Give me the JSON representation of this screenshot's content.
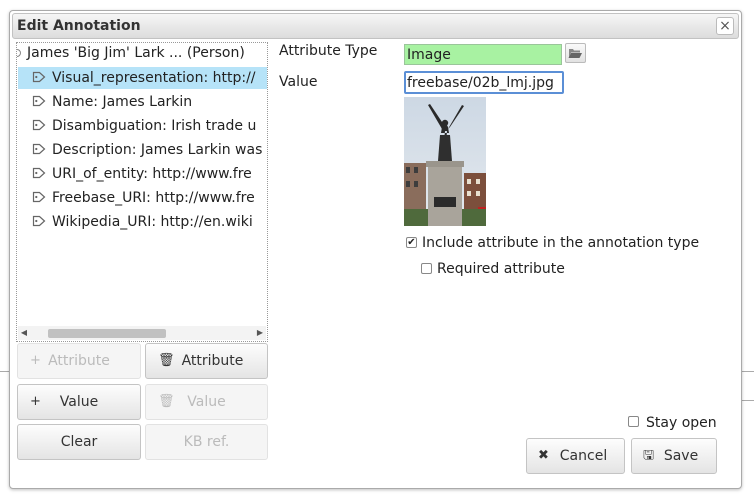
{
  "dialog": {
    "title": "Edit Annotation",
    "close_glyph": "×"
  },
  "tree": {
    "root_label": "James 'Big Jim' Lark ... (Person)",
    "items": [
      {
        "label": "Visual_representation: http://",
        "icon": "tag-icon",
        "selected": true
      },
      {
        "label": "Name: James Larkin",
        "icon": "tag-icon",
        "selected": false
      },
      {
        "label": "Disambiguation: Irish trade u",
        "icon": "tag-icon",
        "selected": false
      },
      {
        "label": "Description: James Larkin was",
        "icon": "tag-icon",
        "selected": false
      },
      {
        "label": "URI_of_entity: http://www.fre",
        "icon": "tag-icon",
        "selected": false
      },
      {
        "label": "Freebase_URI: http://www.fre",
        "icon": "tag-icon",
        "selected": false
      },
      {
        "label": "Wikipedia_URI: http://en.wiki",
        "icon": "tag-icon",
        "selected": false
      }
    ]
  },
  "buttons": {
    "add_attribute": {
      "icon_glyph": "+",
      "label": "Attribute",
      "enabled": false
    },
    "delete_attribute": {
      "icon_glyph": "🗑",
      "label": "Attribute",
      "enabled": true
    },
    "add_value": {
      "icon_glyph": "+",
      "label": "Value",
      "enabled": true
    },
    "delete_value": {
      "icon_glyph": "🗑",
      "label": "Value",
      "enabled": false
    },
    "clear": {
      "label": "Clear",
      "enabled": true
    },
    "kb_ref": {
      "label": "KB ref.",
      "enabled": false
    },
    "cancel": {
      "icon_glyph": "✖",
      "label": "Cancel"
    },
    "save": {
      "icon_glyph": "🖫",
      "label": "Save"
    }
  },
  "form": {
    "attribute_type_label": "Attribute Type",
    "attribute_type_value": "Image",
    "value_label": "Value",
    "value": "freebase/02b_lmj.jpg",
    "include_attribute_label": "Include attribute in the annotation type",
    "include_attribute_checked": true,
    "required_attribute_label": "Required attribute",
    "required_attribute_checked": false,
    "stay_open_label": "Stay open",
    "stay_open_checked": false
  },
  "colors": {
    "selected_row": "#b6e3f8",
    "attribute_type_bg": "#a8f2a2",
    "focus_border": "#5b8fd6"
  }
}
